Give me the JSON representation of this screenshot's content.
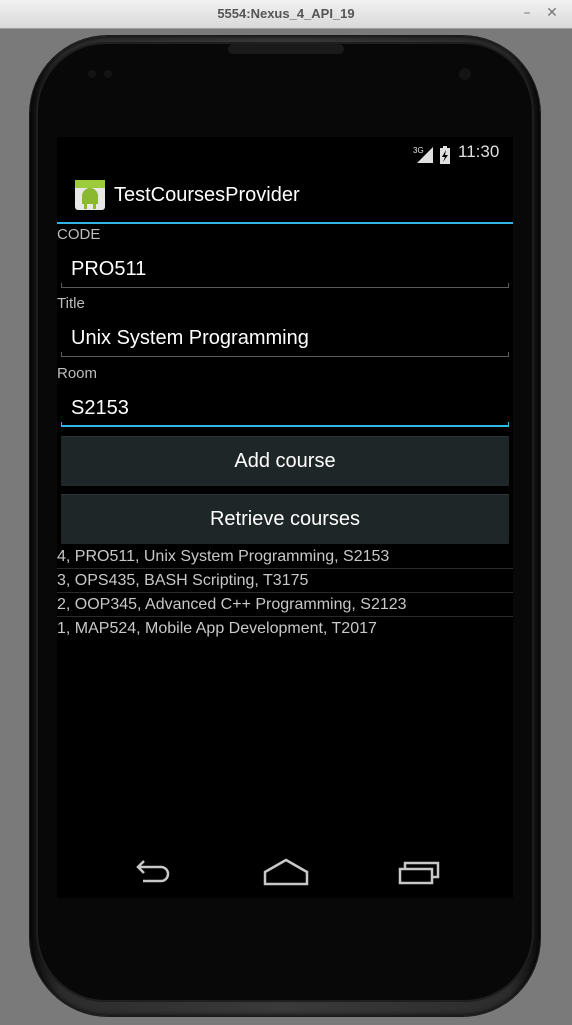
{
  "window": {
    "title": "5554:Nexus_4_API_19",
    "minimize_label": "–",
    "close_label": "✕"
  },
  "status_bar": {
    "network_label": "3G",
    "time": "11:30"
  },
  "action_bar": {
    "app_title": "TestCoursesProvider",
    "app_icon": "android-icon"
  },
  "form": {
    "code": {
      "label": "CODE",
      "value": "PRO511"
    },
    "title": {
      "label": "Title",
      "value": "Unix System Programming"
    },
    "room": {
      "label": "Room",
      "value": "S2153"
    }
  },
  "buttons": {
    "add": "Add course",
    "retrieve": "Retrieve courses"
  },
  "courses": [
    "4, PRO511, Unix System Programming, S2153",
    "3, OPS435, BASH Scripting, T3175",
    "2, OOP345, Advanced C++ Programming, S2123",
    "1, MAP524, Mobile App Development, T2017"
  ],
  "nav_icons": [
    "back-icon",
    "home-icon",
    "recents-icon"
  ],
  "colors": {
    "accent": "#33b5e5",
    "button_bg": "#1f2628",
    "screen_bg": "#000000"
  }
}
